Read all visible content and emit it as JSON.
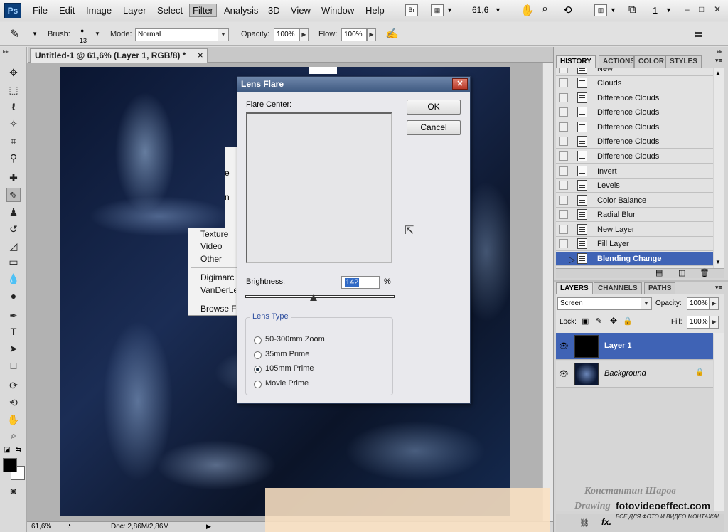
{
  "menubar": {
    "logo": "Ps",
    "items": [
      "File",
      "Edit",
      "Image",
      "Layer",
      "Select",
      "Filter",
      "Analysis",
      "3D",
      "View",
      "Window",
      "Help"
    ],
    "bridge": "Br",
    "zoom": "61,6",
    "workspace": "1",
    "window_controls": [
      "–",
      "□",
      "✕"
    ]
  },
  "options": {
    "brush_label": "Brush:",
    "brush_size": "13",
    "mode_label": "Mode:",
    "mode_value": "Normal",
    "opacity_label": "Opacity:",
    "opacity_value": "100%",
    "flow_label": "Flow:",
    "flow_value": "100%"
  },
  "document": {
    "tab_title": "Untitled-1 @ 61,6% (Layer 1, RGB/8) *",
    "close": "×"
  },
  "context_menu": {
    "fragments": [
      "e",
      "n"
    ],
    "items": [
      "Texture",
      "Video",
      "Other",
      "Digimarc",
      "VanDerLee",
      "Browse Fil"
    ]
  },
  "dialog": {
    "title": "Lens Flare",
    "close": "✕",
    "flare_center_label": "Flare Center:",
    "ok": "OK",
    "cancel": "Cancel",
    "brightness_label": "Brightness:",
    "brightness_value": "142",
    "brightness_unit": "%",
    "lens_type_label": "Lens Type",
    "lens_options": [
      "50-300mm Zoom",
      "35mm Prime",
      "105mm Prime",
      "Movie Prime"
    ],
    "selected_lens": "105mm Prime"
  },
  "history": {
    "tabs": [
      "HISTORY",
      "ACTIONS",
      "COLOR",
      "STYLES"
    ],
    "partial_top": "New",
    "items": [
      "Clouds",
      "Difference Clouds",
      "Difference Clouds",
      "Difference Clouds",
      "Difference Clouds",
      "Difference Clouds",
      "Invert",
      "Levels",
      "Color Balance",
      "Radial Blur",
      "New Layer",
      "Fill Layer",
      "Blending Change"
    ],
    "selected": "Blending Change"
  },
  "layers": {
    "tabs": [
      "LAYERS",
      "CHANNELS",
      "PATHS"
    ],
    "blend_mode": "Screen",
    "opacity_label": "Opacity:",
    "opacity_value": "100%",
    "lock_label": "Lock:",
    "fill_label": "Fill:",
    "fill_value": "100%",
    "items": [
      {
        "name": "Layer 1",
        "selected": true
      },
      {
        "name": "Background",
        "selected": false
      }
    ],
    "fx": "fx."
  },
  "status": {
    "zoom": "61,6%",
    "doc": "Doc: 2,86M/2,86M"
  },
  "watermark": {
    "author": "Константин Шаров",
    "drawing": "Drawing",
    "site": "fotovideoeffect.com",
    "tagline": "ВСЕ ДЛЯ ФОТО И ВИДЕО МОНТАЖА!"
  },
  "colors": {
    "selection_blue": "#3f63b5",
    "dialog_title": "#4f6a94",
    "canvas_dark": "#0b1530"
  }
}
